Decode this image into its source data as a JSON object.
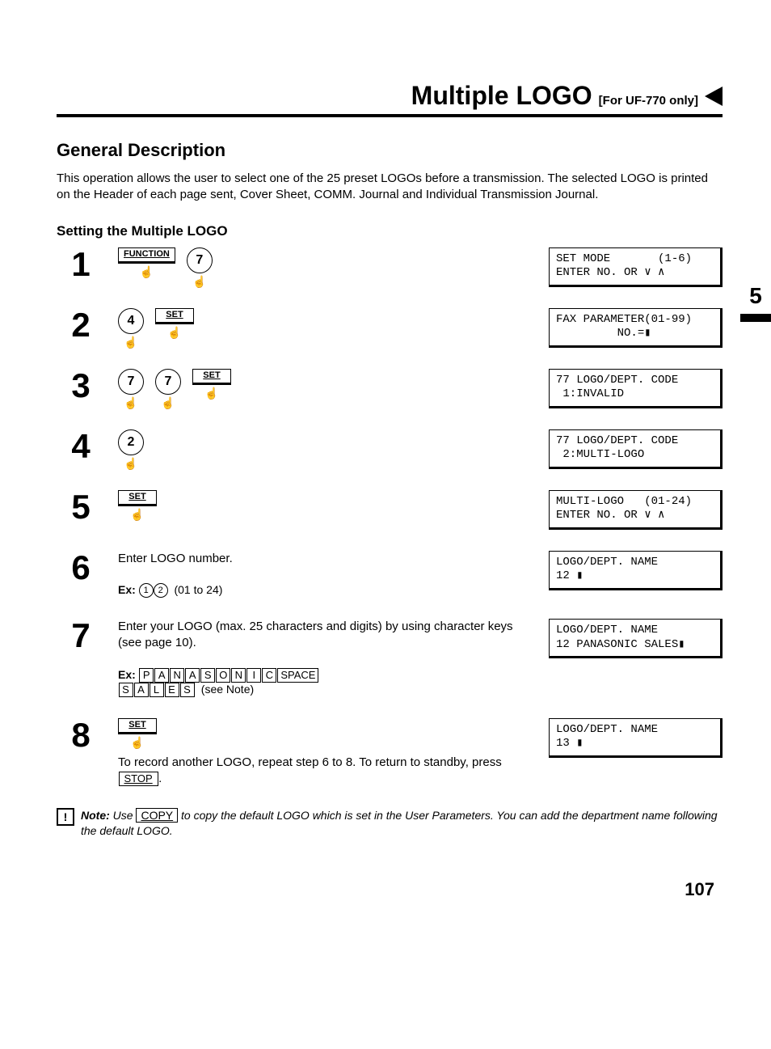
{
  "title": "Multiple LOGO",
  "title_suffix": "[For UF-770 only]",
  "tab_number": "5",
  "section1_heading": "General Description",
  "section1_body": "This operation allows the user to select one of the 25 preset LOGOs before a transmission. The selected LOGO is printed on the Header of each page sent, Cover Sheet, COMM. Journal and Individual Transmission Journal.",
  "section2_heading": "Setting the Multiple LOGO",
  "steps": {
    "s1": {
      "num": "1",
      "keys": [
        "FUNCTION",
        "7"
      ],
      "display": "SET MODE       (1-6)\nENTER NO. OR ∨ ∧"
    },
    "s2": {
      "num": "2",
      "keys": [
        "4",
        "SET"
      ],
      "display": "FAX PARAMETER(01-99)\n         NO.=▮"
    },
    "s3": {
      "num": "3",
      "keys": [
        "7",
        "7",
        "SET"
      ],
      "display": "77 LOGO/DEPT. CODE\n 1:INVALID"
    },
    "s4": {
      "num": "4",
      "keys": [
        "2"
      ],
      "display": "77 LOGO/DEPT. CODE\n 2:MULTI-LOGO"
    },
    "s5": {
      "num": "5",
      "keys": [
        "SET"
      ],
      "display": "MULTI-LOGO   (01-24)\nENTER NO. OR ∨ ∧"
    },
    "s6": {
      "num": "6",
      "instr": "Enter LOGO number.",
      "ex_prefix": "Ex:",
      "ex_keys": [
        "1",
        "2"
      ],
      "ex_suffix": "(01 to 24)",
      "display": "LOGO/DEPT. NAME\n12 ▮"
    },
    "s7": {
      "num": "7",
      "instr": "Enter your LOGO (max. 25 characters and digits) by using character keys (see page 10).",
      "ex_prefix": "Ex:",
      "line1": [
        "P",
        "A",
        "N",
        "A",
        "S",
        "O",
        "N",
        "I",
        "C",
        "SPACE"
      ],
      "line2": [
        "S",
        "A",
        "L",
        "E",
        "S"
      ],
      "line2_suffix": "(see Note)",
      "display": "LOGO/DEPT. NAME\n12 PANASONIC SALES▮"
    },
    "s8": {
      "num": "8",
      "keys": [
        "SET"
      ],
      "instr": "To record another LOGO, repeat step 6 to 8. To return to standby, press ",
      "instr_key": "STOP",
      "instr_after": ".",
      "display": "LOGO/DEPT. NAME\n13 ▮"
    }
  },
  "note": {
    "label": "Note:",
    "before": "Use ",
    "key": "COPY",
    "after": " to copy the default LOGO which is set in the User Parameters. You can add the department name following the default LOGO."
  },
  "page_number": "107"
}
